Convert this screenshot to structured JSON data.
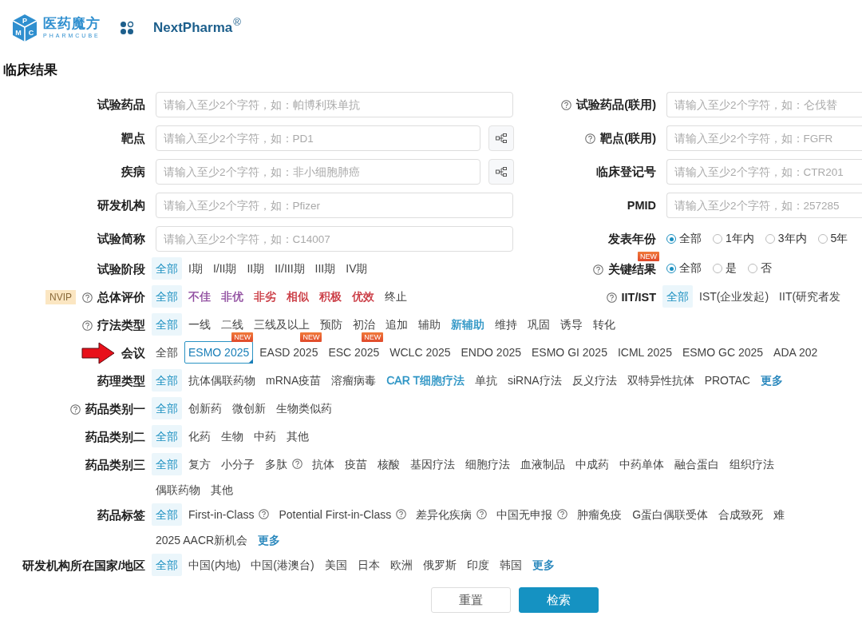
{
  "header": {
    "logo_cn": "医药魔方",
    "logo_en": "PHARMCUBE",
    "logo_letters": [
      "P",
      "M",
      "C"
    ],
    "product": "NextPharma",
    "product_mark": "®"
  },
  "title": "临床结果",
  "rows": [
    {
      "left": {
        "kind": "input",
        "label": "试验药品",
        "placeholder": "请输入至少2个字符，如：帕博利珠单抗"
      },
      "right": {
        "kind": "input",
        "label": "试验药品(联用)",
        "help": true,
        "placeholder": "请输入至少2个字符，如：仑伐替"
      }
    },
    {
      "left": {
        "kind": "input",
        "label": "靶点",
        "placeholder": "请输入至少2个字符，如：PD1",
        "tree_button": true
      },
      "right": {
        "kind": "input",
        "label": "靶点(联用)",
        "help": true,
        "placeholder": "请输入至少2个字符，如：FGFR"
      }
    },
    {
      "left": {
        "kind": "input",
        "label": "疾病",
        "placeholder": "请输入至少2个字符，如：非小细胞肺癌",
        "tree_button": true
      },
      "right": {
        "kind": "input",
        "label": "临床登记号",
        "placeholder": "请输入至少2个字符，如：CTR201"
      }
    },
    {
      "left": {
        "kind": "input",
        "label": "研发机构",
        "placeholder": "请输入至少2个字符，如：Pfizer"
      },
      "right": {
        "kind": "input",
        "label": "PMID",
        "placeholder": "请输入至少2个字符，如：257285"
      }
    },
    {
      "left": {
        "kind": "input",
        "label": "试验简称",
        "placeholder": "请输入至少2个字符，如：C14007"
      },
      "right": {
        "kind": "radio",
        "label": "发表年份",
        "options": [
          {
            "text": "全部",
            "selected": true
          },
          {
            "text": "1年内",
            "selected": false
          },
          {
            "text": "3年内",
            "selected": false
          },
          {
            "text": "5年",
            "selected": false
          }
        ]
      }
    },
    {
      "left": {
        "kind": "options",
        "label": "试验阶段",
        "lines": [
          [
            {
              "text": "全部",
              "selected": true
            },
            {
              "text": "I期",
              "selected": false
            },
            {
              "text": "I/II期",
              "selected": false
            },
            {
              "text": "II期",
              "selected": false
            },
            {
              "text": "II/III期",
              "selected": false
            },
            {
              "text": "III期",
              "selected": false
            },
            {
              "text": "IV期",
              "selected": false
            }
          ]
        ]
      },
      "right": {
        "kind": "radio",
        "label": "关键结果",
        "help": true,
        "label_badge": "NEW",
        "options": [
          {
            "text": "全部",
            "selected": true
          },
          {
            "text": "是",
            "selected": false
          },
          {
            "text": "否",
            "selected": false
          }
        ]
      }
    },
    {
      "left": {
        "kind": "options",
        "label": "总体评价",
        "help": true,
        "tag": "NVIP",
        "lines": [
          [
            {
              "text": "全部",
              "selected": true
            },
            {
              "text": "不佳",
              "selected": false,
              "color": "#8e4a9e"
            },
            {
              "text": "非优",
              "selected": false,
              "color": "#8e4a9e"
            },
            {
              "text": "非劣",
              "selected": false,
              "color": "#c8333c"
            },
            {
              "text": "相似",
              "selected": false,
              "color": "#c8333c"
            },
            {
              "text": "积极",
              "selected": false,
              "color": "#c8333c"
            },
            {
              "text": "优效",
              "selected": false,
              "color": "#c8333c"
            },
            {
              "text": "终止",
              "selected": false
            }
          ]
        ]
      },
      "right": {
        "kind": "options",
        "label": "IIT/IST",
        "help": true,
        "lines": [
          [
            {
              "text": "全部",
              "selected": true
            },
            {
              "text": "IST(企业发起)",
              "selected": false
            },
            {
              "text": "IIT(研究者发",
              "selected": false
            }
          ]
        ]
      }
    },
    {
      "left": {
        "kind": "options",
        "label": "疗法类型",
        "help": true,
        "lines": [
          [
            {
              "text": "全部",
              "selected": true
            },
            {
              "text": "一线",
              "selected": false
            },
            {
              "text": "二线",
              "selected": false
            },
            {
              "text": "三线及以上",
              "selected": false
            },
            {
              "text": "预防",
              "selected": false
            },
            {
              "text": "初治",
              "selected": false
            },
            {
              "text": "追加",
              "selected": false
            },
            {
              "text": "辅助",
              "selected": false
            },
            {
              "text": "新辅助",
              "selected": false,
              "color": "#2a93c4"
            },
            {
              "text": "维持",
              "selected": false
            },
            {
              "text": "巩固",
              "selected": false
            },
            {
              "text": "诱导",
              "selected": false
            },
            {
              "text": "转化",
              "selected": false
            }
          ]
        ]
      }
    },
    {
      "left": {
        "kind": "options",
        "label": "会议",
        "pointer": true,
        "lines": [
          [
            {
              "text": "全部",
              "selected": false
            },
            {
              "text": "ESMO 2025",
              "selected": false,
              "outlined": true,
              "badge": "NEW"
            },
            {
              "text": "EASD 2025",
              "selected": false,
              "badge": "NEW"
            },
            {
              "text": "ESC 2025",
              "selected": false,
              "badge": "NEW"
            },
            {
              "text": "WCLC 2025",
              "selected": false
            },
            {
              "text": "ENDO 2025",
              "selected": false
            },
            {
              "text": "ESMO GI 2025",
              "selected": false
            },
            {
              "text": "ICML 2025",
              "selected": false
            },
            {
              "text": "ESMO GC 2025",
              "selected": false
            },
            {
              "text": "ADA 202",
              "selected": false
            }
          ]
        ]
      }
    },
    {
      "left": {
        "kind": "options",
        "label": "药理类型",
        "lines": [
          [
            {
              "text": "全部",
              "selected": true
            },
            {
              "text": "抗体偶联药物",
              "selected": false
            },
            {
              "text": "mRNA疫苗",
              "selected": false
            },
            {
              "text": "溶瘤病毒",
              "selected": false
            },
            {
              "text": "CAR T细胞疗法",
              "selected": false,
              "color": "#2a93c4"
            },
            {
              "text": "单抗",
              "selected": false
            },
            {
              "text": "siRNA疗法",
              "selected": false
            },
            {
              "text": "反义疗法",
              "selected": false
            },
            {
              "text": "双特异性抗体",
              "selected": false
            },
            {
              "text": "PROTAC",
              "selected": false
            },
            {
              "text": "更多",
              "selected": false,
              "color": "#1a7fb8"
            }
          ]
        ]
      }
    },
    {
      "left": {
        "kind": "options",
        "label": "药品类别一",
        "help": true,
        "lines": [
          [
            {
              "text": "全部",
              "selected": true
            },
            {
              "text": "创新药",
              "selected": false
            },
            {
              "text": "微创新",
              "selected": false
            },
            {
              "text": "生物类似药",
              "selected": false
            }
          ]
        ]
      }
    },
    {
      "left": {
        "kind": "options",
        "label": "药品类别二",
        "lines": [
          [
            {
              "text": "全部",
              "selected": true
            },
            {
              "text": "化药",
              "selected": false
            },
            {
              "text": "生物",
              "selected": false
            },
            {
              "text": "中药",
              "selected": false
            },
            {
              "text": "其他",
              "selected": false
            }
          ]
        ]
      }
    },
    {
      "left": {
        "kind": "options",
        "label": "药品类别三",
        "lines": [
          [
            {
              "text": "全部",
              "selected": true
            },
            {
              "text": "复方",
              "selected": false
            },
            {
              "text": "小分子",
              "selected": false
            },
            {
              "text": "多肽",
              "selected": false,
              "help": true
            },
            {
              "text": "抗体",
              "selected": false
            },
            {
              "text": "疫苗",
              "selected": false
            },
            {
              "text": "核酸",
              "selected": false
            },
            {
              "text": "基因疗法",
              "selected": false
            },
            {
              "text": "细胞疗法",
              "selected": false
            },
            {
              "text": "血液制品",
              "selected": false
            },
            {
              "text": "中成药",
              "selected": false
            },
            {
              "text": "中药单体",
              "selected": false
            },
            {
              "text": "融合蛋白",
              "selected": false
            },
            {
              "text": "组织疗法",
              "selected": false
            }
          ],
          [
            {
              "text": "偶联药物",
              "selected": false
            },
            {
              "text": "其他",
              "selected": false
            }
          ]
        ]
      }
    },
    {
      "left": {
        "kind": "options",
        "label": "药品标签",
        "lines": [
          [
            {
              "text": "全部",
              "selected": true
            },
            {
              "text": "First-in-Class",
              "selected": false,
              "help": true
            },
            {
              "text": "Potential First-in-Class",
              "selected": false,
              "help": true
            },
            {
              "text": "差异化疾病",
              "selected": false,
              "help": true
            },
            {
              "text": "中国无申报",
              "selected": false,
              "help": true
            },
            {
              "text": "肿瘤免疫",
              "selected": false
            },
            {
              "text": "G蛋白偶联受体",
              "selected": false
            },
            {
              "text": "合成致死",
              "selected": false
            },
            {
              "text": "难",
              "selected": false
            }
          ],
          [
            {
              "text": "2025 AACR新机会",
              "selected": false
            },
            {
              "text": "更多",
              "selected": false,
              "color": "#1a7fb8"
            }
          ]
        ]
      }
    },
    {
      "left": {
        "kind": "options",
        "label": "研发机构所在国家/地区",
        "lines": [
          [
            {
              "text": "全部",
              "selected": true
            },
            {
              "text": "中国(内地)",
              "selected": false
            },
            {
              "text": "中国(港澳台)",
              "selected": false
            },
            {
              "text": "美国",
              "selected": false
            },
            {
              "text": "日本",
              "selected": false
            },
            {
              "text": "欧洲",
              "selected": false
            },
            {
              "text": "俄罗斯",
              "selected": false
            },
            {
              "text": "印度",
              "selected": false
            },
            {
              "text": "韩国",
              "selected": false
            },
            {
              "text": "更多",
              "selected": false,
              "color": "#1a7fb8"
            }
          ]
        ]
      }
    }
  ],
  "buttons": [
    {
      "kind": "secondary",
      "label": "重置"
    },
    {
      "kind": "primary",
      "label": "检索"
    }
  ]
}
